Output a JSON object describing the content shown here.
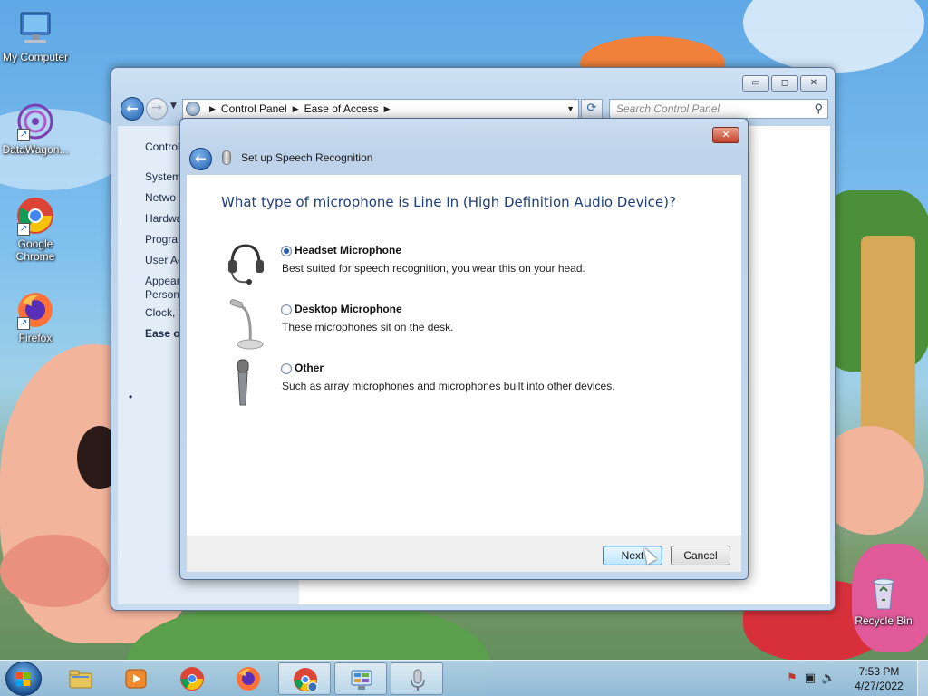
{
  "desktop": {
    "icons": [
      {
        "label": "My Computer",
        "icon": "computer-icon"
      },
      {
        "label": "DataWagon...",
        "icon": "datawagon-icon"
      },
      {
        "label": "Google Chrome",
        "icon": "chrome-icon"
      },
      {
        "label": "Firefox",
        "icon": "firefox-icon"
      },
      {
        "label": "Recycle Bin",
        "icon": "recycle-bin-icon"
      }
    ]
  },
  "explorer": {
    "breadcrumb": [
      "Control Panel",
      "Ease of Access"
    ],
    "search_placeholder": "Search Control Panel",
    "left_nav": [
      "Control",
      "System",
      "Netwo",
      "Hardwa",
      "Progra",
      "User Ac",
      "Appear",
      "Persona",
      "Clock, L",
      "Ease of"
    ],
    "current_item": "Ease of",
    "window_buttons": {
      "minimize": "▭",
      "maximize": "◻",
      "close": "✕"
    }
  },
  "dialog": {
    "title": "Set up Speech Recognition",
    "question": "What type of microphone is Line In (High Definition Audio Device)?",
    "options": [
      {
        "label": "Headset Microphone",
        "description": "Best suited for speech recognition, you wear this on your head.",
        "selected": true
      },
      {
        "label": "Desktop Microphone",
        "description": "These microphones sit on the desk.",
        "selected": false
      },
      {
        "label": "Other",
        "description": "Such as array microphones and microphones built into other devices.",
        "selected": false
      }
    ],
    "next_label": "Next",
    "cancel_label": "Cancel",
    "close_label": "✕"
  },
  "taskbar": {
    "pinned": [
      "file-explorer-icon",
      "media-player-icon",
      "chrome-icon",
      "firefox-icon",
      "chrome-remote-icon",
      "control-panel-icon",
      "speech-recognition-icon"
    ],
    "clock": {
      "time": "7:53 PM",
      "date": "4/27/2022"
    }
  },
  "colors": {
    "accent": "#1f5fb0",
    "question_text": "#1f3f7a",
    "close_red": "#c4412b"
  }
}
